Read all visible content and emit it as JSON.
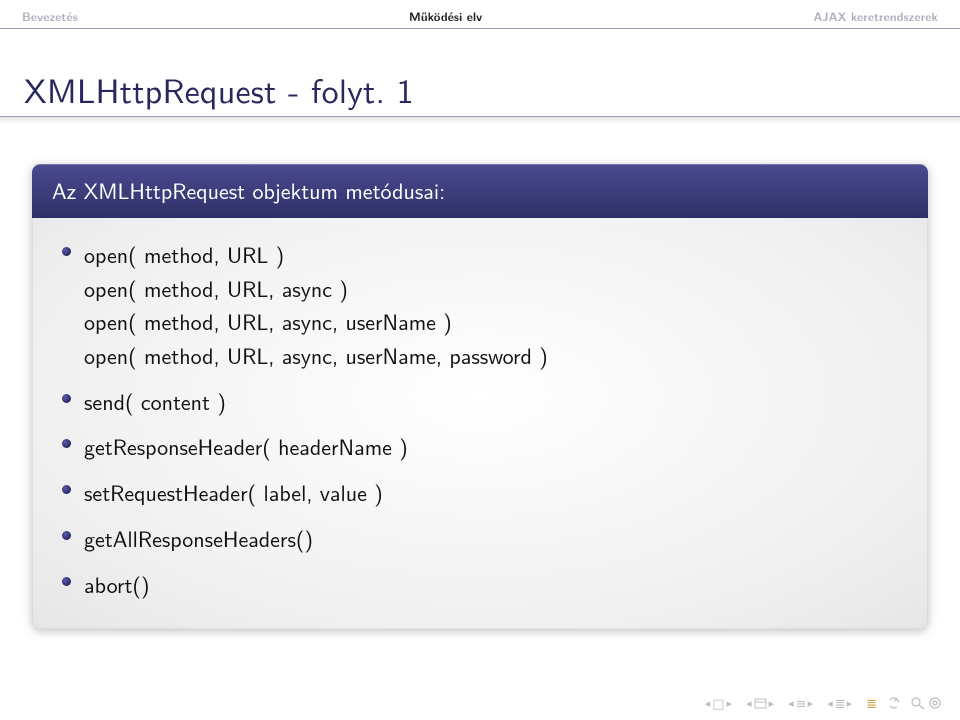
{
  "nav": {
    "left": "Bevezetés",
    "center": "Működési elv",
    "right": "AJAX keretrendszerek"
  },
  "title": "XMLHttpRequest - folyt. 1",
  "block": {
    "title": "Az XMLHttpRequest objektum metódusai:",
    "items": [
      {
        "lines": [
          "open( method, URL )",
          "open( method, URL, async )",
          "open( method, URL, async, userName )",
          "open( method, URL, async, userName, password )"
        ]
      },
      {
        "lines": [
          "send( content )"
        ]
      },
      {
        "lines": [
          "getResponseHeader( headerName )"
        ]
      },
      {
        "lines": [
          "setRequestHeader( label, value )"
        ]
      },
      {
        "lines": [
          "getAllResponseHeaders()"
        ]
      },
      {
        "lines": [
          "abort()"
        ]
      }
    ]
  },
  "footer_icons": {
    "first": "first-slide",
    "prev": "prev-slide",
    "prev_section": "prev-section",
    "next_section": "next-section",
    "prev_sub": "prev-subsection",
    "next_sub": "next-subsection",
    "toc": "toc",
    "back": "back",
    "search": "search"
  },
  "colors": {
    "structure": "#28285e",
    "nav_inactive": "#b0b0c0",
    "footer_icon": "#bdbdbd",
    "block_title_bg": "#3b3b78"
  }
}
